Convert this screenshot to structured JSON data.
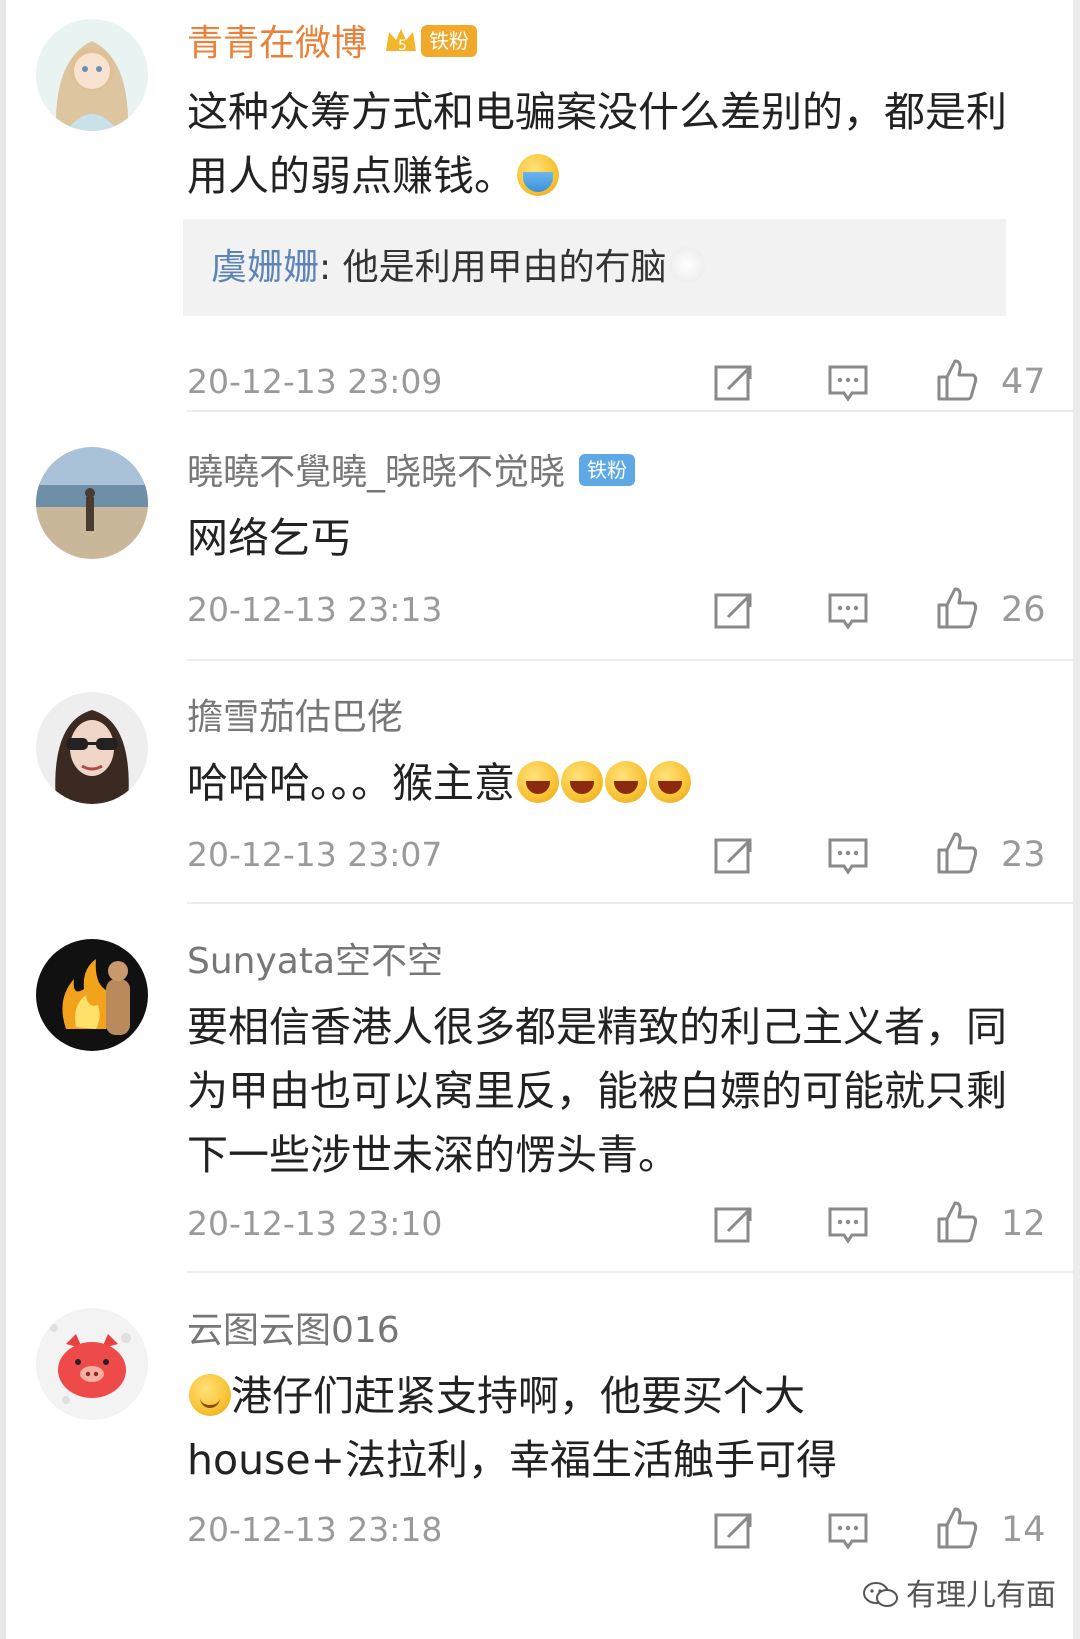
{
  "comments": [
    {
      "username": "青青在微博",
      "badge": "铁粉",
      "text": "这种众筹方式和电骗案没什么差别的，都是利用人的弱点赚钱。",
      "reply": {
        "author": "虞姗姗",
        "sep": ": ",
        "text": "他是利用甲由的冇脑"
      },
      "time": "20-12-13 23:09",
      "likes": "47"
    },
    {
      "username": "曉曉不覺曉_晓晓不觉晓",
      "badge": "铁粉",
      "text": "网络乞丐",
      "time": "20-12-13 23:13",
      "likes": "26"
    },
    {
      "username": "擔雪茄估巴佬",
      "text": "哈哈哈。。。猴主意",
      "time": "20-12-13 23:07",
      "likes": "23"
    },
    {
      "username": "Sunyata空不空",
      "text": "要相信香港人很多都是精致的利己主义者，同为甲由也可以窝里反，能被白嫖的可能就只剩下一些涉世未深的愣头青。",
      "time": "20-12-13 23:10",
      "likes": "12"
    },
    {
      "username": "云图云图016",
      "text": "港仔们赶紧支持啊，他要买个大house+法拉利，幸福生活触手可得",
      "time": "20-12-13 23:18",
      "likes": "14"
    }
  ],
  "watermark": "有理儿有面",
  "icons": {
    "share": "share-icon",
    "reply": "comment-icon",
    "like": "thumbs-up-icon"
  },
  "colors": {
    "vip_name": "#e8823a",
    "reply_author": "#5d84b8",
    "gold_badge": "#f1a92a",
    "blue_badge": "#5ea8e6"
  }
}
